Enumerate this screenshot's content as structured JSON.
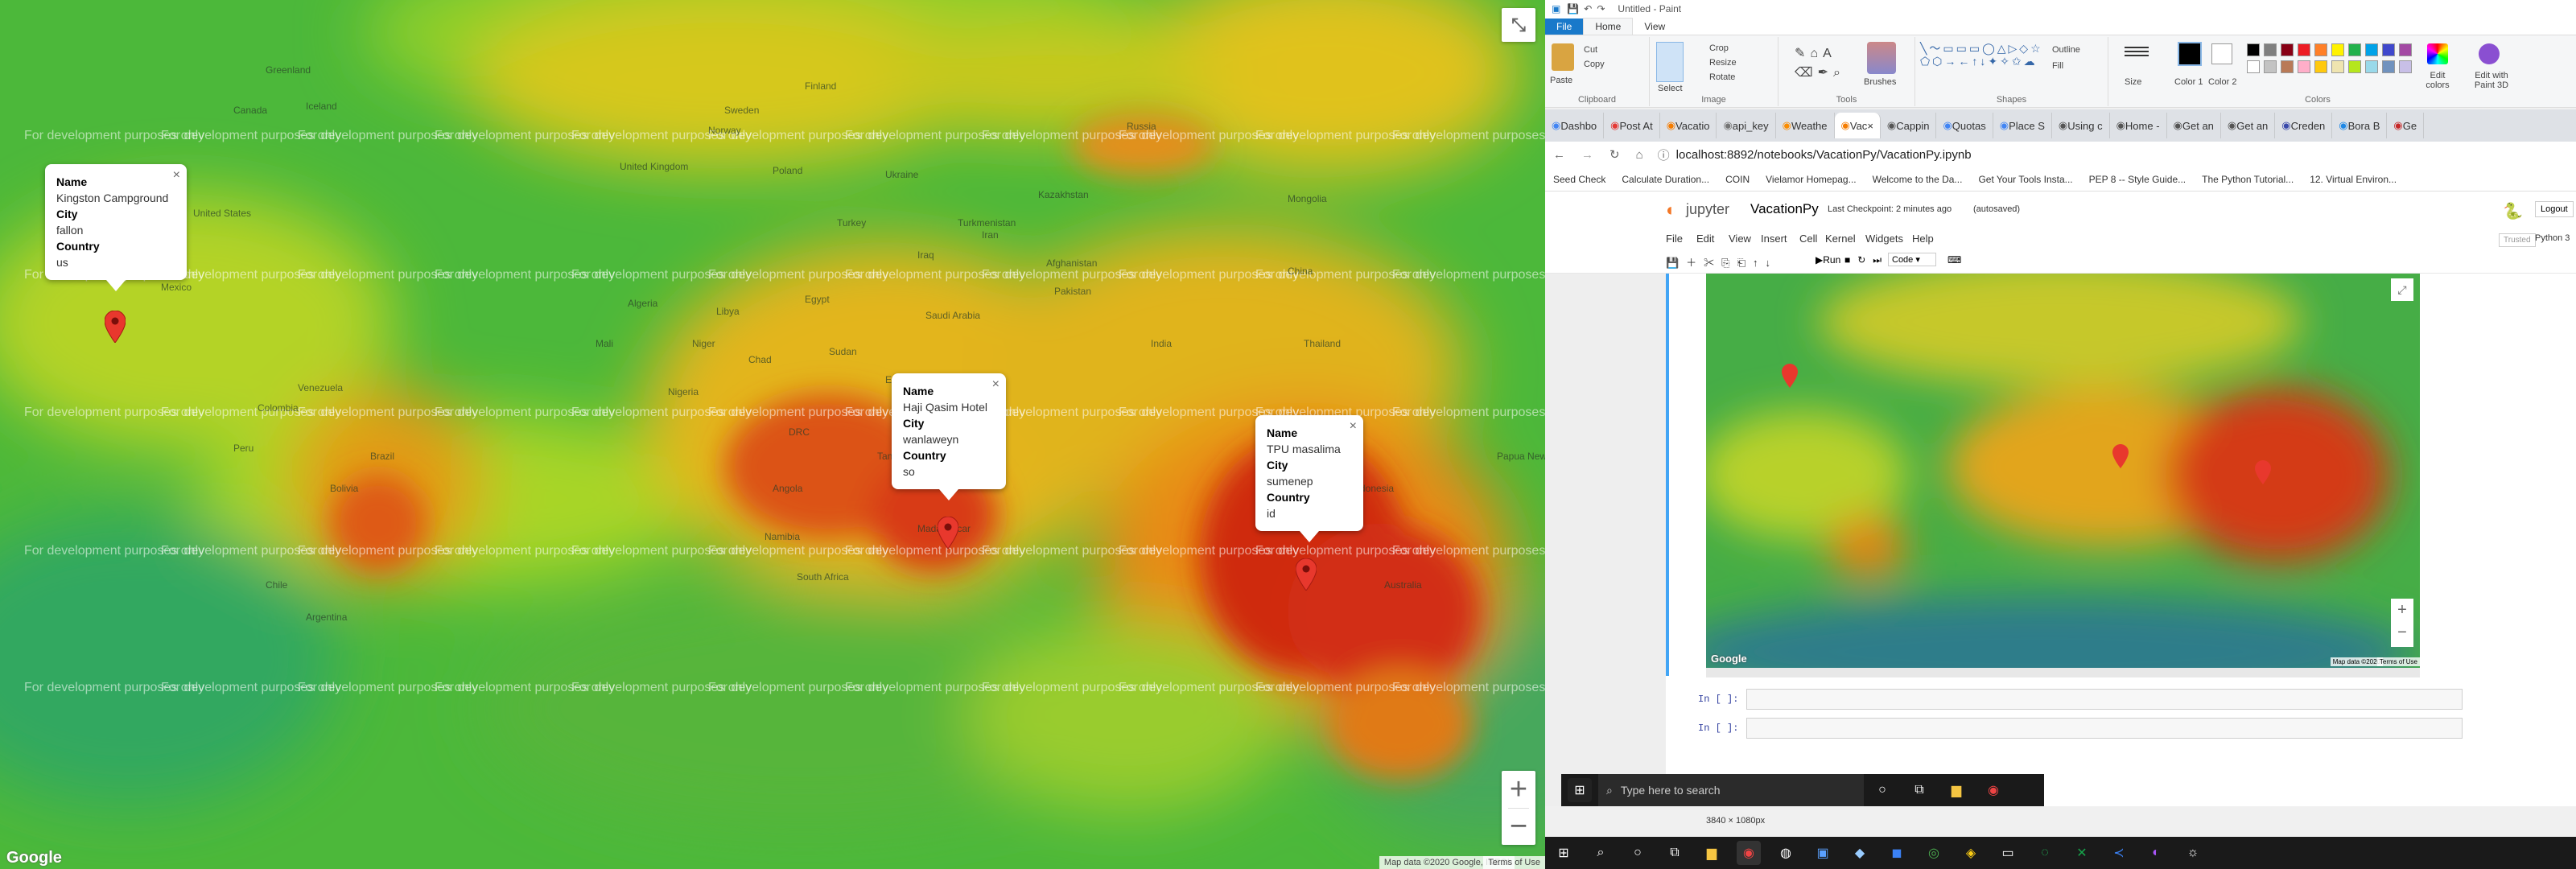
{
  "left_map": {
    "watermark": "For development purposes only",
    "attribution": "Map data ©2020 Google, INEGI",
    "terms": "Terms of Use",
    "google": "Google",
    "labels": [
      "Greenland",
      "Iceland",
      "Finland",
      "Sweden",
      "Norway",
      "United Kingdom",
      "Poland",
      "Ukraine",
      "Russia",
      "Kazakhstan",
      "Mongolia",
      "Turkmenistan",
      "Turkey",
      "Afghanistan",
      "Iraq",
      "Iran",
      "Pakistan",
      "Egypt",
      "Libya",
      "Algeria",
      "Mali",
      "Niger",
      "Chad",
      "Sudan",
      "Ethiopia",
      "Kenya",
      "Nigeria",
      "DRC",
      "Angola",
      "Namibia",
      "South Africa",
      "Madagascar",
      "Saudi Arabia",
      "India",
      "China",
      "Thailand",
      "Indonesia",
      "Papua New Guinea",
      "Australia",
      "Canada",
      "United States",
      "Mexico",
      "Venezuela",
      "Colombia",
      "Peru",
      "Brazil",
      "Bolivia",
      "Argentina",
      "Chile",
      "Tanzania"
    ]
  },
  "popups": [
    {
      "name_label": "Name",
      "name": "Kingston Campground",
      "city_label": "City",
      "city": "fallon",
      "country_label": "Country",
      "country": "us"
    },
    {
      "name_label": "Name",
      "name": "Haji Qasim Hotel",
      "city_label": "City",
      "city": "wanlaweyn",
      "country_label": "Country",
      "country": "so"
    },
    {
      "name_label": "Name",
      "name": "TPU masalima",
      "city_label": "City",
      "city": "sumenep",
      "country_label": "Country",
      "country": "id"
    }
  ],
  "paint": {
    "title": "Untitled - Paint",
    "tabs": [
      "File",
      "Home",
      "View"
    ],
    "groups": [
      "Clipboard",
      "Image",
      "Tools",
      "Shapes",
      "Colors"
    ],
    "clipboard": {
      "paste": "Paste",
      "cut": "Cut",
      "copy": "Copy"
    },
    "image": {
      "select": "Select",
      "crop": "Crop",
      "resize": "Resize",
      "rotate": "Rotate"
    },
    "brushes": "Brushes",
    "outline": "Outline",
    "fill": "Fill",
    "size": "Size",
    "color1": "Color 1",
    "color2": "Color 2",
    "edit_colors": "Edit colors",
    "edit_paint3d": "Edit with Paint 3D",
    "palette": [
      "#000000",
      "#7f7f7f",
      "#880015",
      "#ed1c24",
      "#ff7f27",
      "#fff200",
      "#22b14c",
      "#00a2e8",
      "#3f48cc",
      "#a349a4",
      "#ffffff",
      "#c3c3c3",
      "#b97a57",
      "#ffaec9",
      "#ffc90e",
      "#efe4b0",
      "#b5e61d",
      "#99d9ea",
      "#7092be",
      "#c8bfe7"
    ]
  },
  "browser": {
    "tabs": [
      "Dashbo",
      "Post At",
      "Vacatio",
      "api_key",
      "Weathe",
      "Vac",
      "Cappin",
      "Quotas",
      "Place S",
      "Using c",
      "Home -",
      "Get an",
      "Get an",
      "Creden",
      "Bora B",
      "Ge"
    ],
    "url": "localhost:8892/notebooks/VacationPy/VacationPy.ipynb",
    "bookmarks": [
      "Seed Check",
      "Calculate Duration...",
      "COIN",
      "Vielamor Homepag...",
      "Welcome to the Da...",
      "Get Your Tools Insta...",
      "PEP 8 -- Style Guide...",
      "The Python Tutorial...",
      "12. Virtual Environ..."
    ]
  },
  "jupyter": {
    "logo": "jupyter",
    "notebook": "VacationPy",
    "checkpoint": "Last Checkpoint: 2 minutes ago",
    "autosaved": "(autosaved)",
    "logout": "Logout",
    "menu": [
      "File",
      "Edit",
      "View",
      "Insert",
      "Cell",
      "Kernel",
      "Widgets",
      "Help"
    ],
    "trusted": "Trusted",
    "kernel": "Python 3",
    "run": "Run",
    "cell_type": "Code",
    "prompt1": "In [ ]:",
    "prompt2": "In [ ]:",
    "mini_attrib": "Map data ©2020",
    "mini_terms": "Terms of Use",
    "mini_google": "Google"
  },
  "taskbar": {
    "search": "Type here to search",
    "status": "3840 × 1080px"
  }
}
